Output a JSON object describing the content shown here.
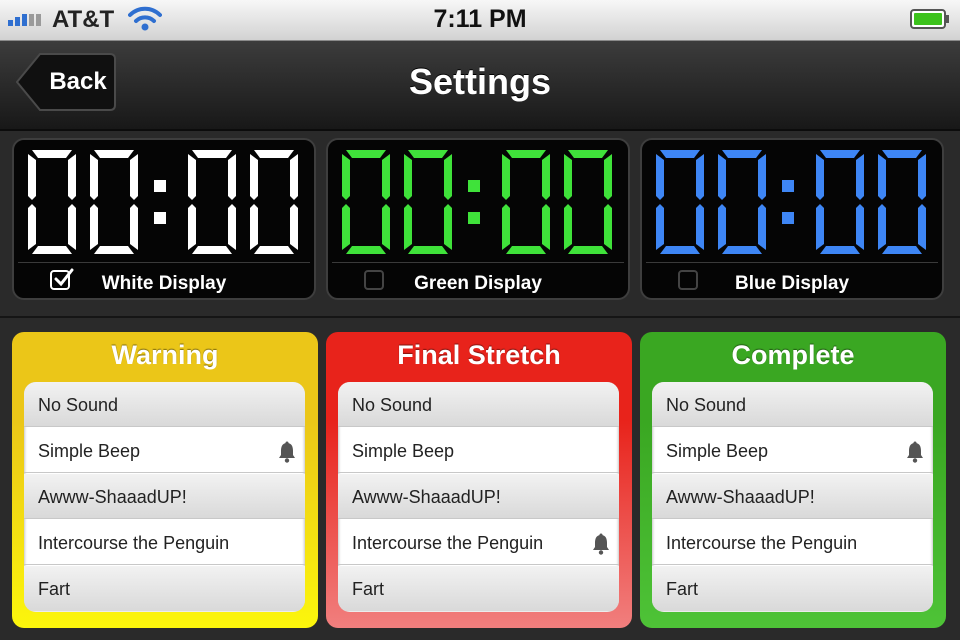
{
  "status": {
    "carrier": "AT&T",
    "time": "7:11 PM",
    "icons": {
      "signal": "signal-bars-icon",
      "wifi": "wifi-icon",
      "battery": "battery-icon"
    },
    "battery_color": "#3cc21c"
  },
  "nav": {
    "back_label": "Back",
    "title": "Settings"
  },
  "displays": [
    {
      "time": "00:00",
      "label": "White Display",
      "color": "#ffffff",
      "checked": true
    },
    {
      "time": "00:00",
      "label": "Green Display",
      "color": "#3fe23a",
      "checked": false
    },
    {
      "time": "00:00",
      "label": "Blue Display",
      "color": "#3e86f5",
      "checked": false
    }
  ],
  "sounds": [
    {
      "title": "Warning",
      "color_top": "#ebc618",
      "color_bottom": "#fcf60c",
      "selected": "Simple Beep",
      "items": [
        "No Sound",
        "Simple Beep",
        "Awww-ShaaadUP!",
        "Intercourse the Penguin",
        "Fart"
      ]
    },
    {
      "title": "Final Stretch",
      "color_top": "#e8231b",
      "color_bottom": "#f17f7e",
      "selected": "Intercourse the Penguin",
      "items": [
        "No Sound",
        "Simple Beep",
        "Awww-ShaaadUP!",
        "Intercourse the Penguin",
        "Fart"
      ]
    },
    {
      "title": "Complete",
      "color_top": "#3aa722",
      "color_bottom": "#4ec337",
      "selected": "Simple Beep",
      "items": [
        "No Sound",
        "Simple Beep",
        "Awww-ShaaadUP!",
        "Intercourse the Penguin",
        "Fart"
      ]
    }
  ],
  "icons": {
    "check": "checkmark-icon",
    "bell": "bell-icon",
    "back": "back-arrow-icon"
  }
}
